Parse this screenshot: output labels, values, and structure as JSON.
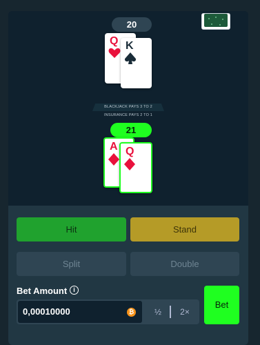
{
  "dealer": {
    "score": "20",
    "cards": [
      {
        "rank": "Q",
        "suit": "hearts",
        "color": "red"
      },
      {
        "rank": "K",
        "suit": "spades",
        "color": "black"
      }
    ]
  },
  "table_text": {
    "line1": "BLACKJACK PAYS 3 TO 2",
    "line2": "INSURANCE PAYS 2 TO 1"
  },
  "player": {
    "score": "21",
    "cards": [
      {
        "rank": "A",
        "suit": "diamonds",
        "color": "red"
      },
      {
        "rank": "Q",
        "suit": "diamonds",
        "color": "red"
      }
    ]
  },
  "actions": {
    "hit": "Hit",
    "stand": "Stand",
    "split": "Split",
    "double": "Double"
  },
  "bet": {
    "label": "Bet Amount",
    "info_icon": "i",
    "amount": "0,00010000",
    "currency_icon": "₿",
    "half": "½",
    "double": "2×",
    "submit": "Bet"
  },
  "colors": {
    "background": "#0f212e",
    "panel": "#213743",
    "win_green": "#1fff20",
    "hit_green": "#20a22e",
    "stand_gold": "#b59b27",
    "suit_red": "#e9113c"
  }
}
